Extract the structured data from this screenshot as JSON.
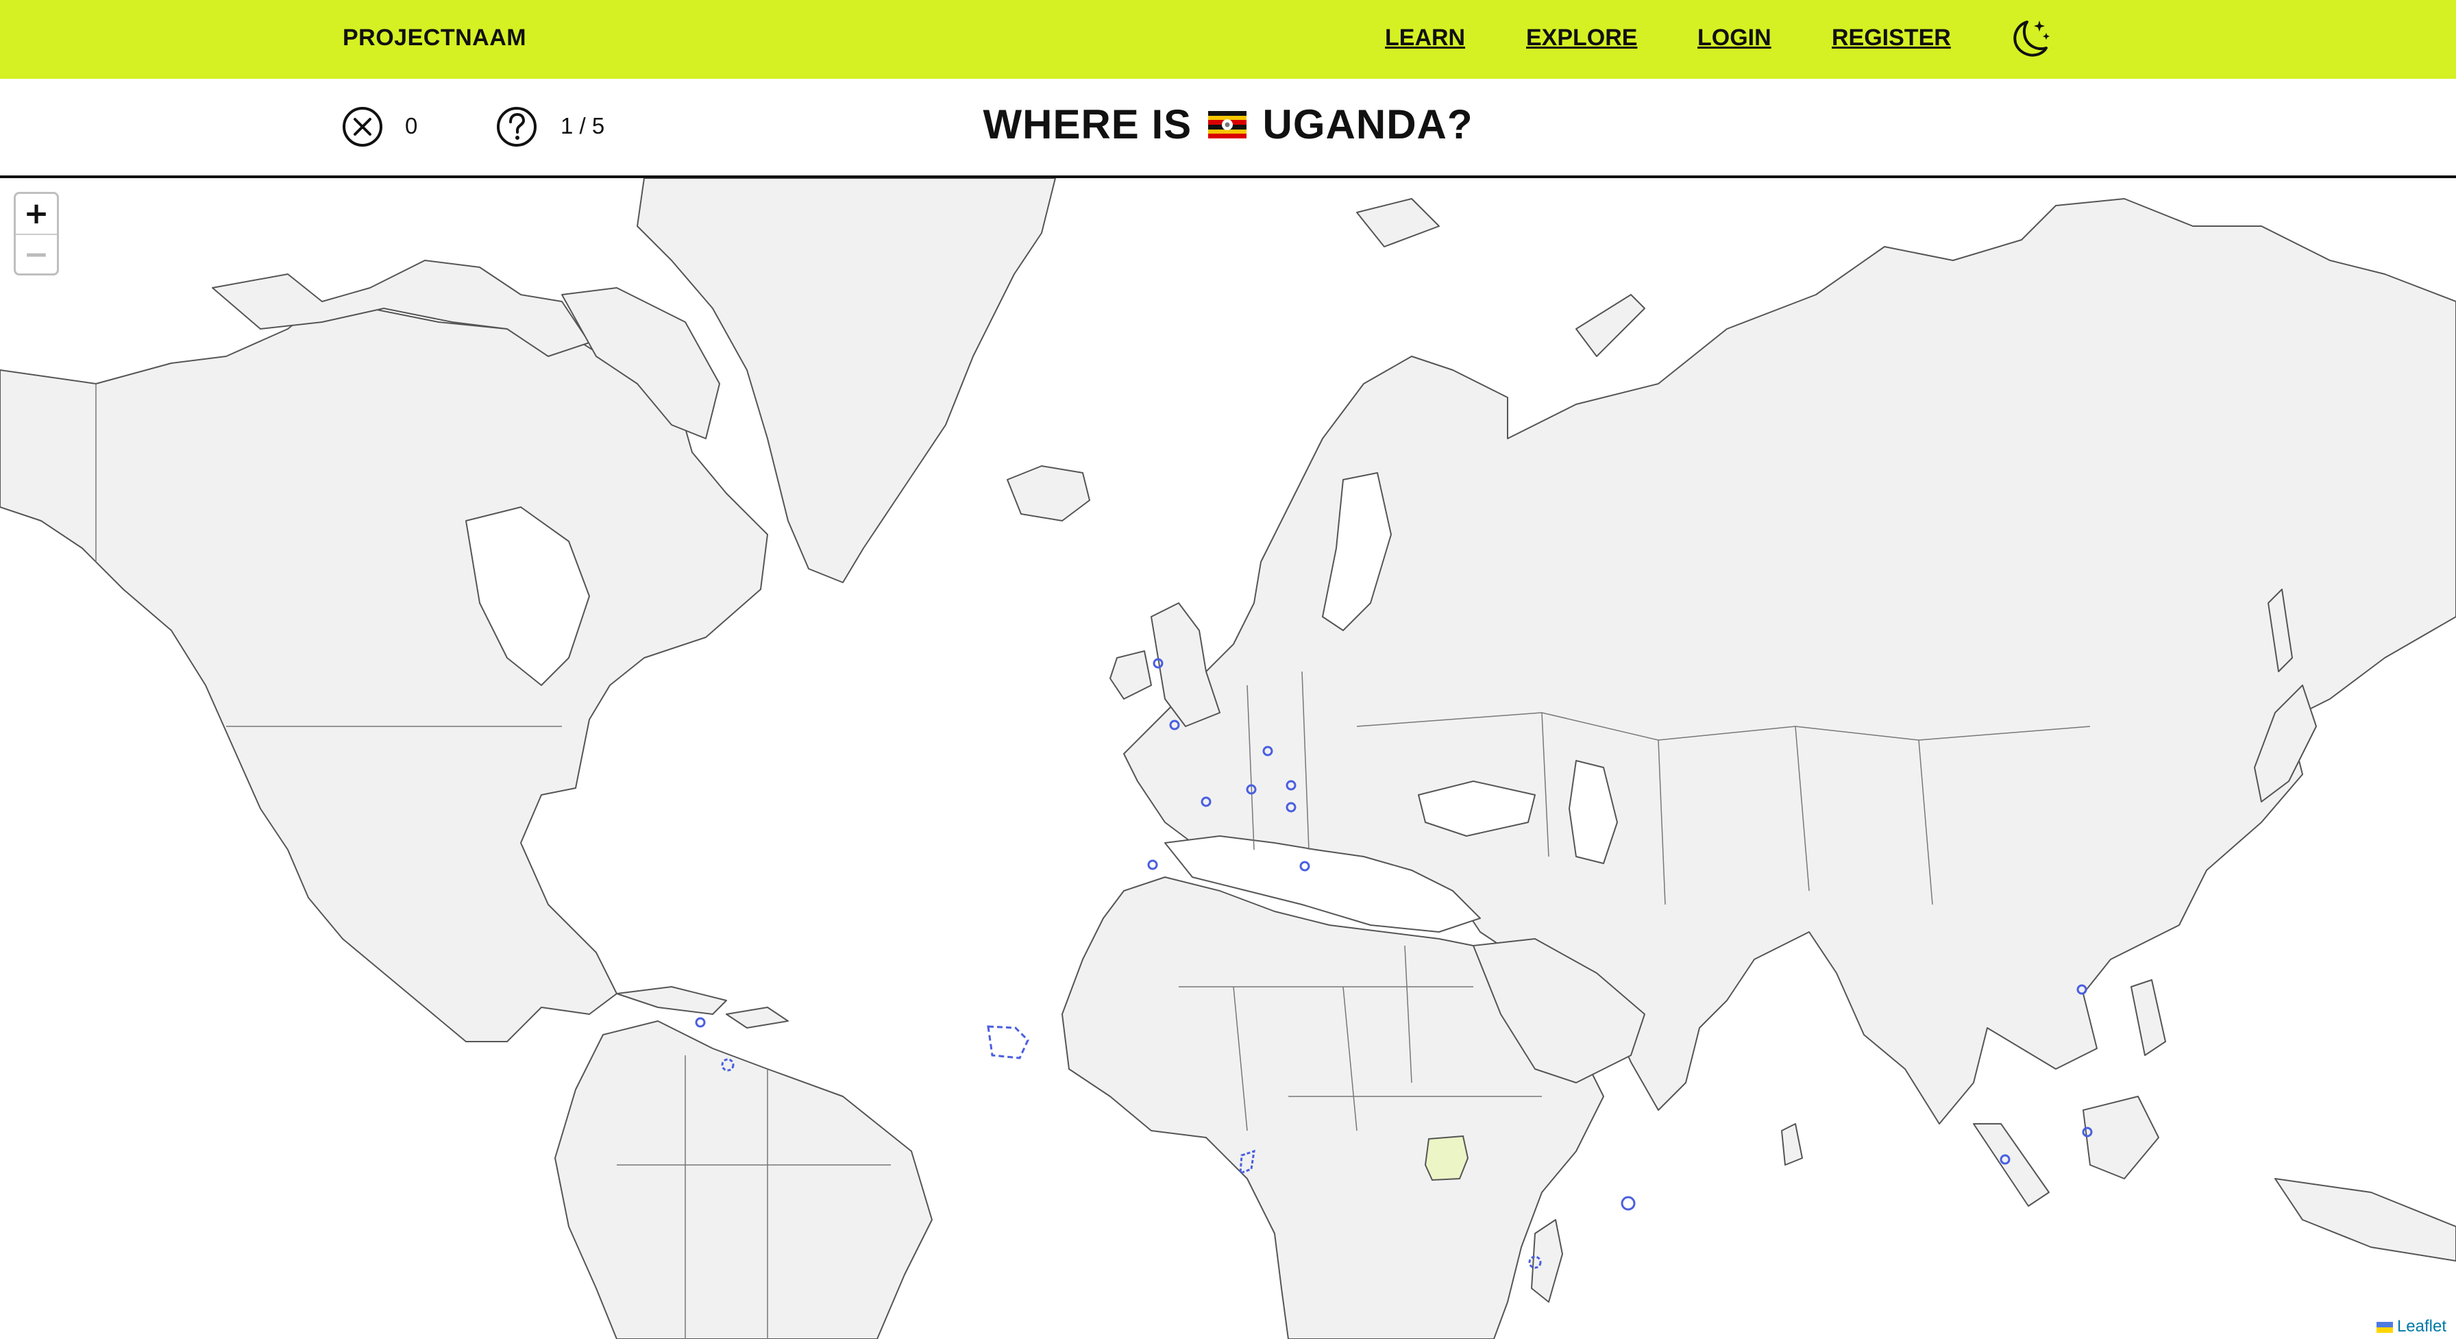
{
  "navbar": {
    "brand": "PROJECTNAAM",
    "links": [
      "LEARN",
      "EXPLORE",
      "LOGIN",
      "REGISTER"
    ],
    "theme_toggle_icon": "moon-stars-icon",
    "background": "#d5f123"
  },
  "quiz": {
    "errors_icon": "x-circle-icon",
    "errors": "0",
    "progress_icon": "question-circle-icon",
    "progress": "1 / 5",
    "question_prefix": "WHERE IS",
    "flag_icon": "uganda-flag-icon",
    "country": "UGANDA?"
  },
  "map": {
    "zoom_in": "+",
    "zoom_out": "−",
    "attribution": "Leaflet",
    "highlight_color": "#ecf5c6",
    "land_color": "#f1f1f1",
    "border_color": "#555555",
    "small_country_marker_color": "#4a5fe0"
  }
}
